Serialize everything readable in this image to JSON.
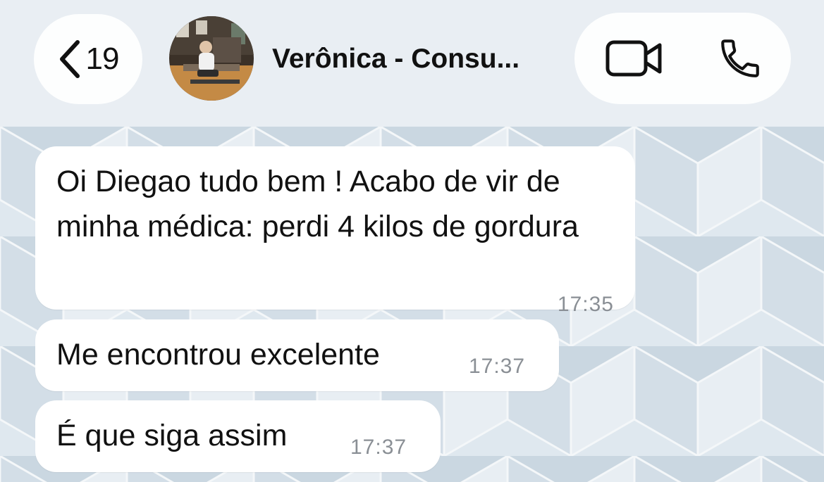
{
  "header": {
    "back_count": "19",
    "contact_name": "Verônica - Consu...",
    "icons": {
      "back": "chevron-left-icon",
      "video": "video-camera-icon",
      "call": "phone-icon"
    }
  },
  "messages": [
    {
      "text": "Oi Diegao tudo bem ! Acabo de vir de minha médica: perdi 4 kilos de gordura",
      "time": "17:35"
    },
    {
      "text": "Me encontrou excelente",
      "time": "17:37"
    },
    {
      "text": "É que siga assim",
      "time": "17:37"
    }
  ],
  "colors": {
    "header_bg": "#e9eef3",
    "chat_bg": "#dfe8ef",
    "bubble_bg": "#ffffff",
    "timestamp": "#8a8f95"
  }
}
